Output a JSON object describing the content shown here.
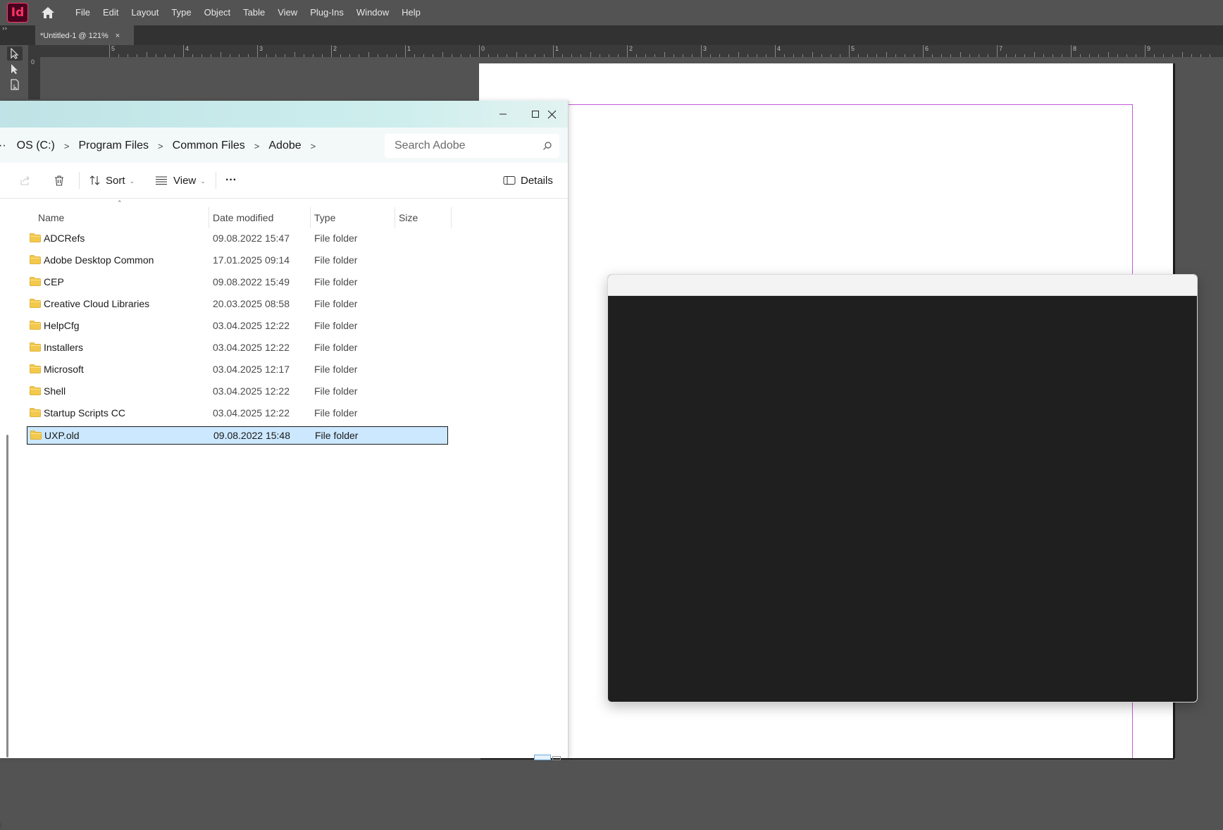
{
  "app": {
    "logo_text": "Id",
    "menu": [
      "File",
      "Edit",
      "Layout",
      "Type",
      "Object",
      "Table",
      "View",
      "Plug-Ins",
      "Window",
      "Help"
    ],
    "document_tab": {
      "title": "*Untitled-1 @ 121%",
      "close": "×"
    },
    "toolbox_collapse": "››",
    "ruler": {
      "h_labels": [
        "5",
        "4",
        "3",
        "2",
        "1",
        "0",
        "1",
        "2",
        "3",
        "4",
        "5",
        "6",
        "7",
        "8",
        "9"
      ],
      "v_labels": [
        "0"
      ]
    },
    "margin_color": "#c35ad6",
    "accent_color": "#ff3366"
  },
  "explorer": {
    "title_buttons": [
      "minimize",
      "maximize",
      "close"
    ],
    "breadcrumb": {
      "overflow": "··",
      "items": [
        "OS (C:)",
        "Program Files",
        "Common Files",
        "Adobe"
      ],
      "separator": ">"
    },
    "search": {
      "placeholder": "Search Adobe"
    },
    "commands": {
      "sort_label": "Sort",
      "view_label": "View",
      "more_label": "···",
      "details_label": "Details"
    },
    "columns": {
      "name": "Name",
      "date": "Date modified",
      "type": "Type",
      "size": "Size"
    },
    "rows": [
      {
        "name": "ADCRefs",
        "date": "09.08.2022 15:47",
        "type": "File folder",
        "size": ""
      },
      {
        "name": "Adobe Desktop Common",
        "date": "17.01.2025 09:14",
        "type": "File folder",
        "size": ""
      },
      {
        "name": "CEP",
        "date": "09.08.2022 15:49",
        "type": "File folder",
        "size": ""
      },
      {
        "name": "Creative Cloud Libraries",
        "date": "20.03.2025 08:58",
        "type": "File folder",
        "size": ""
      },
      {
        "name": "HelpCfg",
        "date": "03.04.2025 12:22",
        "type": "File folder",
        "size": ""
      },
      {
        "name": "Installers",
        "date": "03.04.2025 12:22",
        "type": "File folder",
        "size": ""
      },
      {
        "name": "Microsoft",
        "date": "03.04.2025 12:17",
        "type": "File folder",
        "size": ""
      },
      {
        "name": "Shell",
        "date": "03.04.2025 12:22",
        "type": "File folder",
        "size": ""
      },
      {
        "name": "Startup Scripts CC",
        "date": "03.04.2025 12:22",
        "type": "File folder",
        "size": ""
      },
      {
        "name": "UXP.old",
        "date": "09.08.2022 15:48",
        "type": "File folder",
        "size": "",
        "selected": true
      }
    ],
    "left_marker": "i",
    "selection_color": "#cce8ff"
  }
}
